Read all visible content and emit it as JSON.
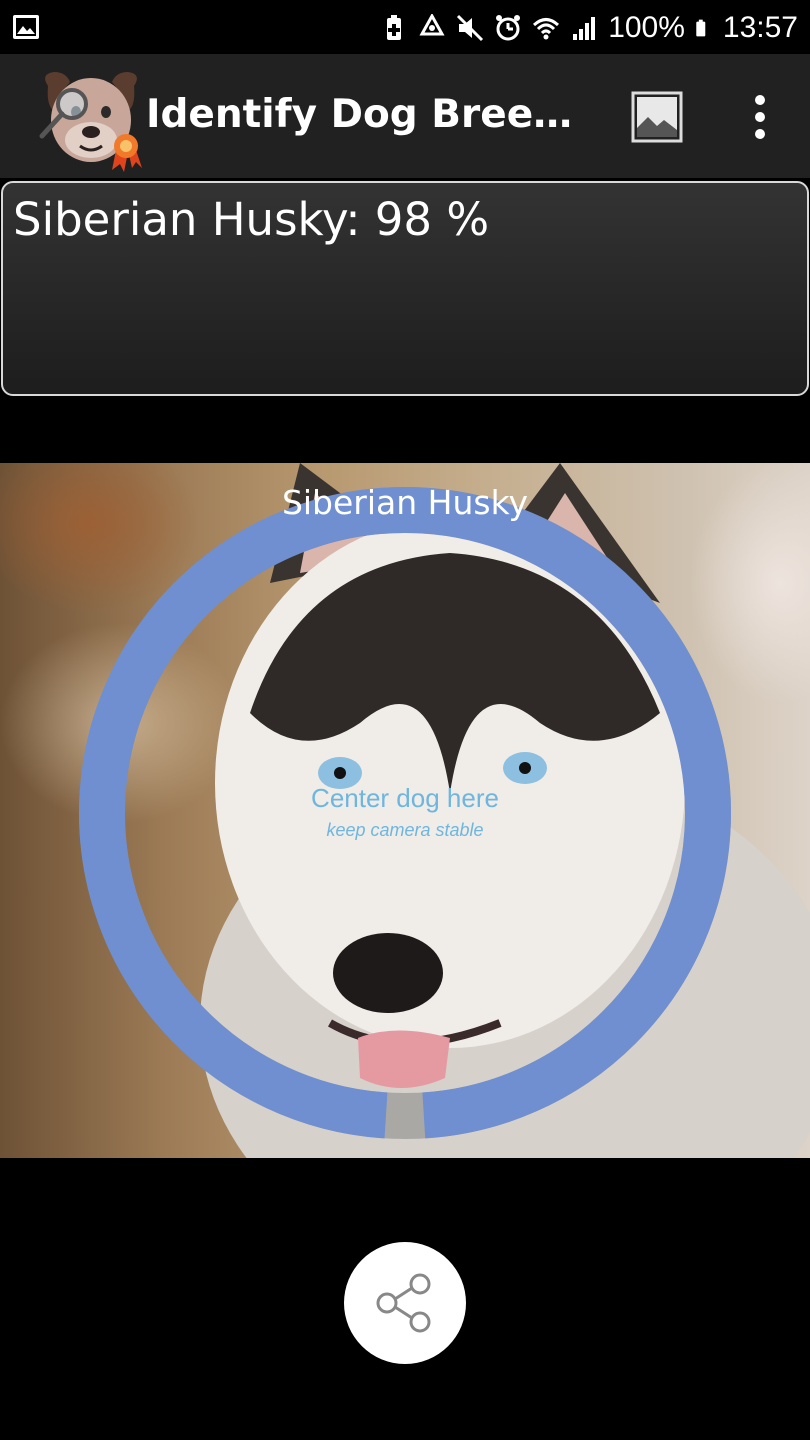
{
  "status_bar": {
    "battery_percent": "100%",
    "time": "13:57",
    "icons": [
      "image-icon",
      "battery-saver-icon",
      "recycle-icon",
      "mute-icon",
      "alarm-icon",
      "wifi-icon",
      "signal-icon",
      "battery-icon"
    ]
  },
  "app_bar": {
    "title": "Identify Dog Breeds...",
    "icons": [
      "dog-logo-icon",
      "gallery-icon",
      "more-vert-icon"
    ]
  },
  "result": {
    "text": "Siberian Husky: 98 %"
  },
  "preview": {
    "ring_label": "Siberian Husky",
    "center_hint": "Center dog here",
    "center_sub": "keep camera stable",
    "progress": 0.98,
    "ring_color": "#6f8fd0"
  },
  "share_button": {
    "icon": "share-icon"
  }
}
